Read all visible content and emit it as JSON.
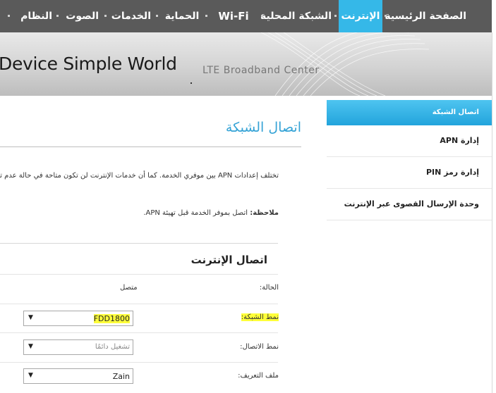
{
  "nav": {
    "items": [
      {
        "label": "الصفحة الرئيسية",
        "active": false
      },
      {
        "label": "الإنترنت",
        "active": true
      },
      {
        "label": "الشبكة المحلية",
        "active": false
      },
      {
        "label": "Wi-Fi",
        "active": false
      },
      {
        "label": "الحماية",
        "active": false
      },
      {
        "label": "الخدمات",
        "active": false
      },
      {
        "label": "الصوت",
        "active": false
      },
      {
        "label": "النظام",
        "active": false
      }
    ]
  },
  "banner": {
    "brand": "Device   Simple World",
    "subtitle": "LTE Broadband Center"
  },
  "sidebar": {
    "items": [
      {
        "label": "اتصال الشبكة",
        "active": true
      },
      {
        "label": "إدارة APN",
        "active": false
      },
      {
        "label": "إدارة رمز PIN",
        "active": false
      },
      {
        "label": "وحدة الإرسال القصوى عبر الإنترنت",
        "active": false
      }
    ]
  },
  "main": {
    "title": "اتصال الشبكة",
    "description": "تختلف إعدادات APN بين موفري الخدمة. كما أن خدمات الإنترنت لن تكون متاحة في حالة عدم تطابق",
    "note_label": "ملاحظة:",
    "note_text": " اتصل بموفر الخدمة قبل تهيئة APN.",
    "section_title": "اتصال الإنترنت",
    "status_label": "الحالة:",
    "status_value": "متصل",
    "network_mode_label": "نمط الشبكة:",
    "network_mode_value": "FDD1800",
    "connection_mode_label": "نمط الاتصال:",
    "connection_mode_value": "تشغيل دائمًا",
    "profile_label": "ملف التعريف:",
    "profile_value": "Zain"
  },
  "colors": {
    "nav_bg": "#5a5a5a",
    "nav_active": "#35b8e8",
    "title_blue": "#35a3d6",
    "highlight": "#ffff3a"
  }
}
